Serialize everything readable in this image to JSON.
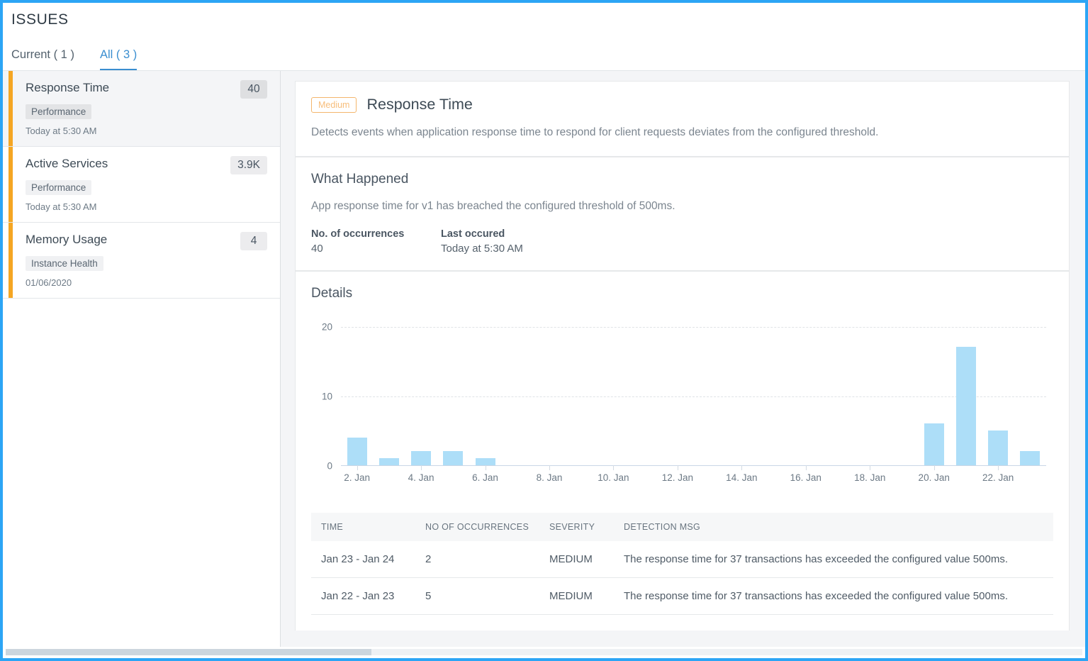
{
  "page_title": "ISSUES",
  "tabs": [
    {
      "label": "Current ( 1 )",
      "active": false
    },
    {
      "label": "All ( 3 )",
      "active": true
    }
  ],
  "accent_colors": {
    "tab_active": "#3a8ed0",
    "item_accent": "#F5A623",
    "severity": "#f4b66c",
    "bar": "#ADDEF8",
    "window_border": "#2CA5F5"
  },
  "issue_list": [
    {
      "title": "Response Time",
      "count": "40",
      "category": "Performance",
      "time": "Today at 5:30 AM",
      "selected": true
    },
    {
      "title": "Active Services",
      "count": "3.9K",
      "category": "Performance",
      "time": "Today at 5:30 AM",
      "selected": false
    },
    {
      "title": "Memory Usage",
      "count": "4",
      "category": "Instance Health",
      "time": "01/06/2020",
      "selected": false
    }
  ],
  "detail": {
    "severity_badge": "Medium",
    "title": "Response Time",
    "description": "Detects events when application response time to respond for client requests deviates from the configured threshold.",
    "what_happened": {
      "heading": "What Happened",
      "text": "App response time for v1 has breached the configured threshold of 500ms.",
      "facts": [
        {
          "label": "No. of occurrences",
          "value": "40"
        },
        {
          "label": "Last occured",
          "value": "Today at 5:30 AM"
        }
      ]
    },
    "details_heading": "Details",
    "table": {
      "columns": [
        "TIME",
        "NO OF OCCURRENCES",
        "SEVERITY",
        "DETECTION MSG"
      ],
      "rows": [
        [
          "Jan 23 - Jan 24",
          "2",
          "MEDIUM",
          "The response time for 37 transactions has exceeded the configured value 500ms."
        ],
        [
          "Jan 22 - Jan 23",
          "5",
          "MEDIUM",
          "The response time for 37 transactions has exceeded the configured value 500ms."
        ]
      ]
    }
  },
  "chart_data": {
    "type": "bar",
    "title": "",
    "xlabel": "",
    "ylabel": "",
    "ylim": [
      0,
      20
    ],
    "yticks": [
      0,
      10,
      20
    ],
    "grid": true,
    "legend": false,
    "x": [
      2,
      3,
      4,
      5,
      6,
      7,
      8,
      9,
      10,
      11,
      12,
      13,
      14,
      15,
      16,
      17,
      18,
      19,
      20,
      21,
      22,
      23
    ],
    "categories": [
      "2. Jan",
      "3. Jan",
      "4. Jan",
      "5. Jan",
      "6. Jan",
      "7. Jan",
      "8. Jan",
      "9. Jan",
      "10. Jan",
      "11. Jan",
      "12. Jan",
      "13. Jan",
      "14. Jan",
      "15. Jan",
      "16. Jan",
      "17. Jan",
      "18. Jan",
      "19. Jan",
      "20. Jan",
      "21. Jan",
      "22. Jan",
      "23. Jan"
    ],
    "values": [
      4,
      1,
      2,
      2,
      1,
      0,
      0,
      0,
      0,
      0,
      0,
      0,
      0,
      0,
      0,
      0,
      0,
      0,
      6,
      17,
      5,
      2
    ],
    "xtick_labels": [
      "2. Jan",
      "4. Jan",
      "6. Jan",
      "8. Jan",
      "10. Jan",
      "12. Jan",
      "14. Jan",
      "16. Jan",
      "18. Jan",
      "20. Jan",
      "22. Jan"
    ],
    "xtick_positions": [
      2,
      4,
      6,
      8,
      10,
      12,
      14,
      16,
      18,
      20,
      22
    ]
  }
}
